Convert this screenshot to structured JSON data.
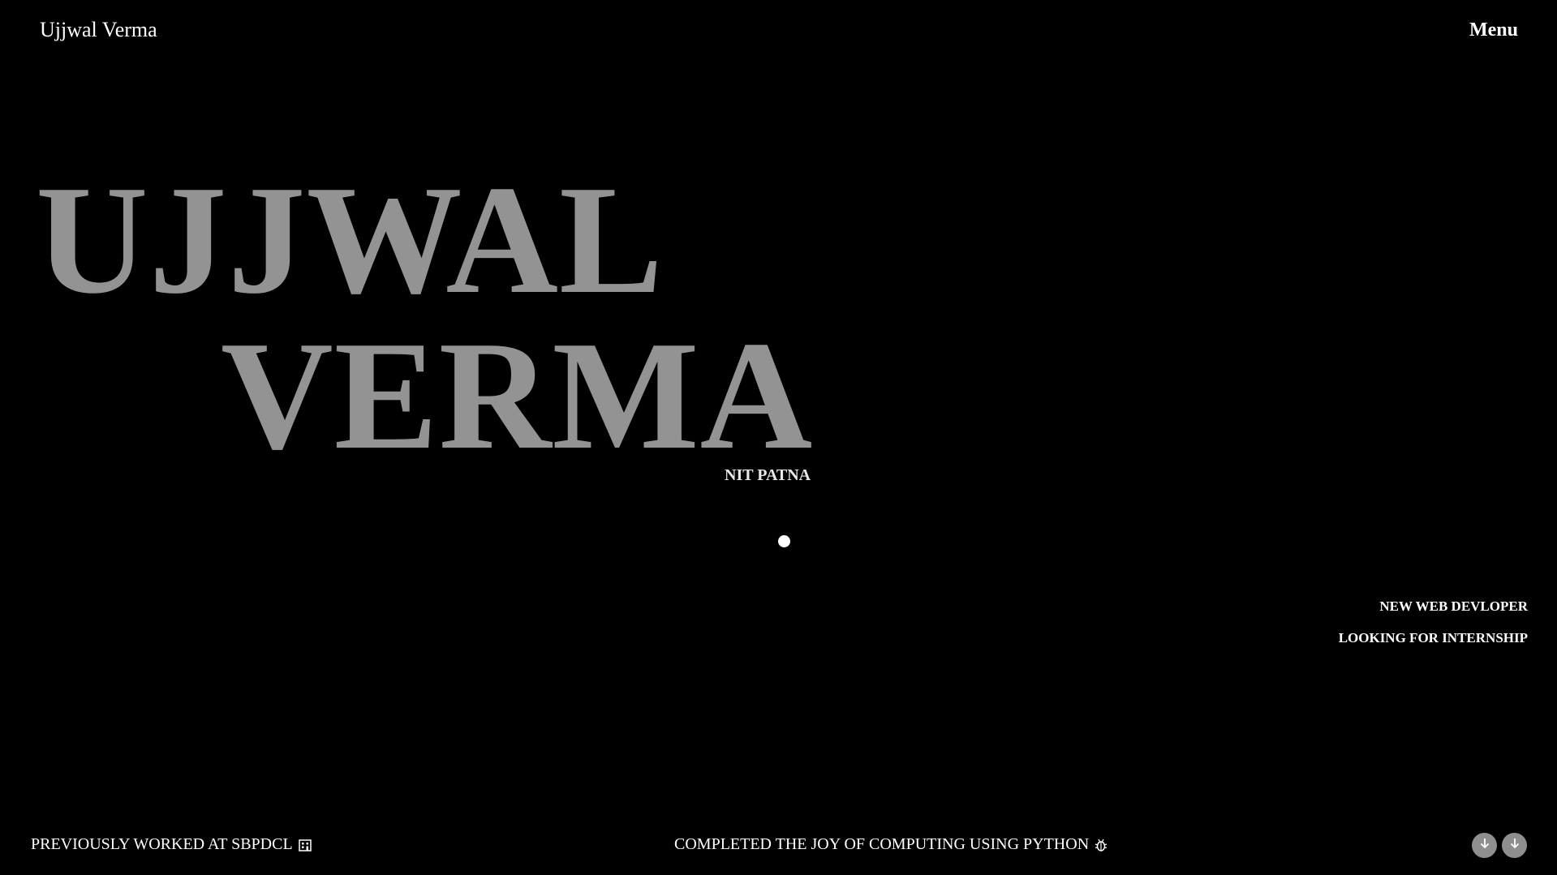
{
  "header": {
    "logo_text": "Ujjwal Verma",
    "menu_label": "Menu"
  },
  "hero": {
    "line1": "UJJWAL",
    "line2": "VERMA",
    "subtitle": "NIT PATNA"
  },
  "side_tags": [
    "NEW WEB DEVLOPER",
    "LOOKING FOR INTERNSHIP"
  ],
  "footer": {
    "left_text": "PREVIOUSLY WORKED AT SBPDCL",
    "left_icon": "building-icon",
    "center_text": "COMPLETED THE JOY OF COMPUTING USING PYTHON",
    "center_icon": "bug-icon",
    "scroll_icons": [
      "arrow-down-icon",
      "arrow-down-icon"
    ]
  },
  "colors": {
    "background": "#000000",
    "hero_text": "#939393",
    "primary_text": "#ffffff",
    "button_bg": "#8f8f8f"
  }
}
